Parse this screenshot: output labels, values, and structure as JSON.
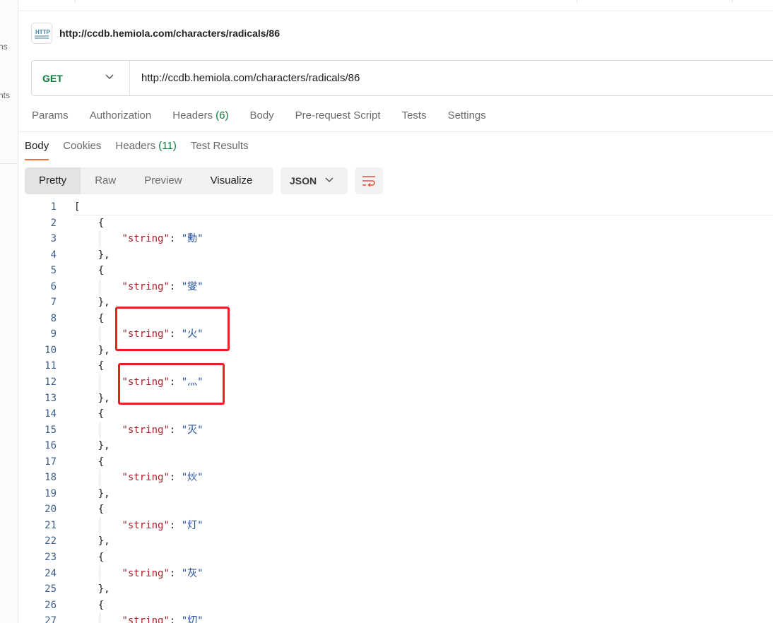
{
  "sidebar": {
    "fragments": [
      "ns",
      "nts"
    ]
  },
  "request": {
    "title": "http://ccdb.hemiola.com/characters/radicals/86",
    "method": "GET",
    "url": "http://ccdb.hemiola.com/characters/radicals/86",
    "http_badge_text": "HTTP"
  },
  "request_tabs": [
    {
      "label": "Params",
      "count": ""
    },
    {
      "label": "Authorization",
      "count": ""
    },
    {
      "label": "Headers",
      "count": "(6)"
    },
    {
      "label": "Body",
      "count": ""
    },
    {
      "label": "Pre-request Script",
      "count": ""
    },
    {
      "label": "Tests",
      "count": ""
    },
    {
      "label": "Settings",
      "count": ""
    }
  ],
  "response_tabs": [
    {
      "label": "Body",
      "count": "",
      "active": true
    },
    {
      "label": "Cookies",
      "count": ""
    },
    {
      "label": "Headers",
      "count": "(11)"
    },
    {
      "label": "Test Results",
      "count": ""
    }
  ],
  "view_modes": [
    "Pretty",
    "Raw",
    "Preview",
    "Visualize"
  ],
  "active_view": "Pretty",
  "format": "JSON",
  "response_body": {
    "key": "string",
    "values": [
      "勳",
      "燮",
      "火",
      "灬",
      "灭",
      "炏",
      "灯",
      "灰",
      "灱"
    ]
  },
  "line_count": 27,
  "highlighted_values": [
    "火",
    "灬"
  ],
  "colors": {
    "accent": "#ff6c37",
    "method_get": "#0b7a3b",
    "json_key": "#a3212c",
    "json_value": "#1f4d9a",
    "line_number": "#3d5f8a",
    "highlight_box": "#e8201f"
  }
}
